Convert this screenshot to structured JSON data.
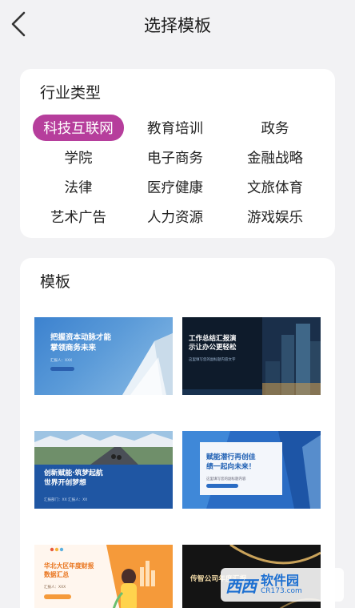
{
  "header": {
    "title": "选择模板",
    "back_icon": "chevron-left-icon"
  },
  "industry": {
    "title": "行业类型",
    "tags": [
      {
        "label": "科技互联网",
        "active": true
      },
      {
        "label": "教育培训",
        "active": false
      },
      {
        "label": "政务",
        "active": false
      },
      {
        "label": "学院",
        "active": false
      },
      {
        "label": "电子商务",
        "active": false
      },
      {
        "label": "金融战略",
        "active": false
      },
      {
        "label": "法律",
        "active": false
      },
      {
        "label": "医疗健康",
        "active": false
      },
      {
        "label": "文旅体育",
        "active": false
      },
      {
        "label": "艺术广告",
        "active": false
      },
      {
        "label": "人力资源",
        "active": false
      },
      {
        "label": "游戏娱乐",
        "active": false
      }
    ],
    "active_color": "#b63e9c"
  },
  "templates": {
    "title": "模板",
    "items": [
      {
        "title": "把握资本动脉才能\n掌领商务未来",
        "subtitle": "汇报人：XXX"
      },
      {
        "title": "工作总结汇报演\n示让办公更轻松",
        "subtitle": "这里填写您的副标题内容文字"
      },
      {
        "title": "创新赋能·筑梦起航\n世界开创梦想",
        "subtitle": "汇报部门：XX 汇报人：XX"
      },
      {
        "title": "赋能潜行再创佳\n绩一起向未来！",
        "subtitle": "这里填写您的副标题内容"
      },
      {
        "title": "华北大区年度财报\n数据汇总",
        "subtitle": "汇报人：XXX"
      },
      {
        "title": "传智公司年度汇报",
        "subtitle": ""
      }
    ]
  },
  "watermark": {
    "logo": "西西",
    "main": "软件园",
    "sub": "CR173.com"
  }
}
